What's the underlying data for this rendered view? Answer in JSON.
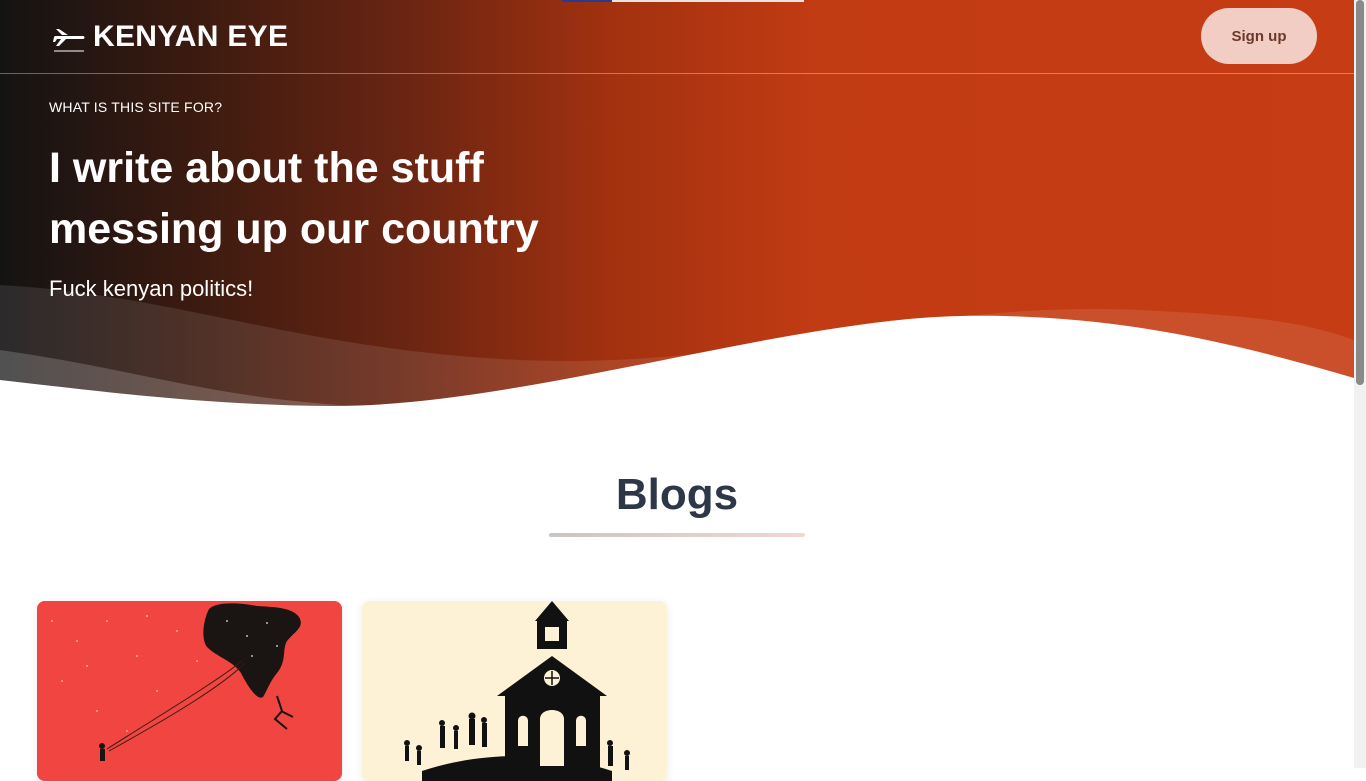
{
  "header": {
    "logo_text": "KENYAN EYE",
    "logo_icon": "airplane-icon",
    "signup_label": "Sign up"
  },
  "hero": {
    "eyebrow": "WHAT IS THIS SITE FOR?",
    "headline": "I write about the stuff messing up our country",
    "subline": "Fuck kenyan politics!"
  },
  "blogs": {
    "title": "Blogs",
    "cards": [
      {
        "image": "africa-balloon-illustration",
        "background": "#f04540"
      },
      {
        "image": "church-silhouette-illustration",
        "background": "#fdf2d6"
      }
    ]
  },
  "colors": {
    "hero_dark": "#141313",
    "hero_orange": "#c63c14",
    "signup_bg": "#f2cdc3",
    "heading": "#2d3748"
  }
}
